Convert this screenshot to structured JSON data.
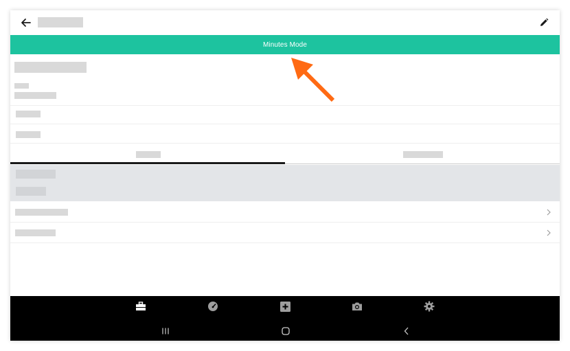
{
  "banner": {
    "label": "Minutes Mode",
    "color": "#1dc39f"
  },
  "icons": {
    "back": "arrow-left-icon",
    "edit": "pencil-icon",
    "nav": [
      "briefcase-icon",
      "gauge-icon",
      "plus-square-icon",
      "camera-icon",
      "gear-icon"
    ],
    "system": [
      "recent-apps-icon",
      "home-icon",
      "back-chevron-icon"
    ],
    "list_chevron": "chevron-right-icon"
  },
  "annotation": {
    "type": "callout-arrow",
    "color": "#ff6a13",
    "points_to": "banner"
  },
  "colors": {
    "nav_bg": "#000000",
    "section_bg": "#e3e5e8",
    "tab_active": "#1a1a1a"
  }
}
